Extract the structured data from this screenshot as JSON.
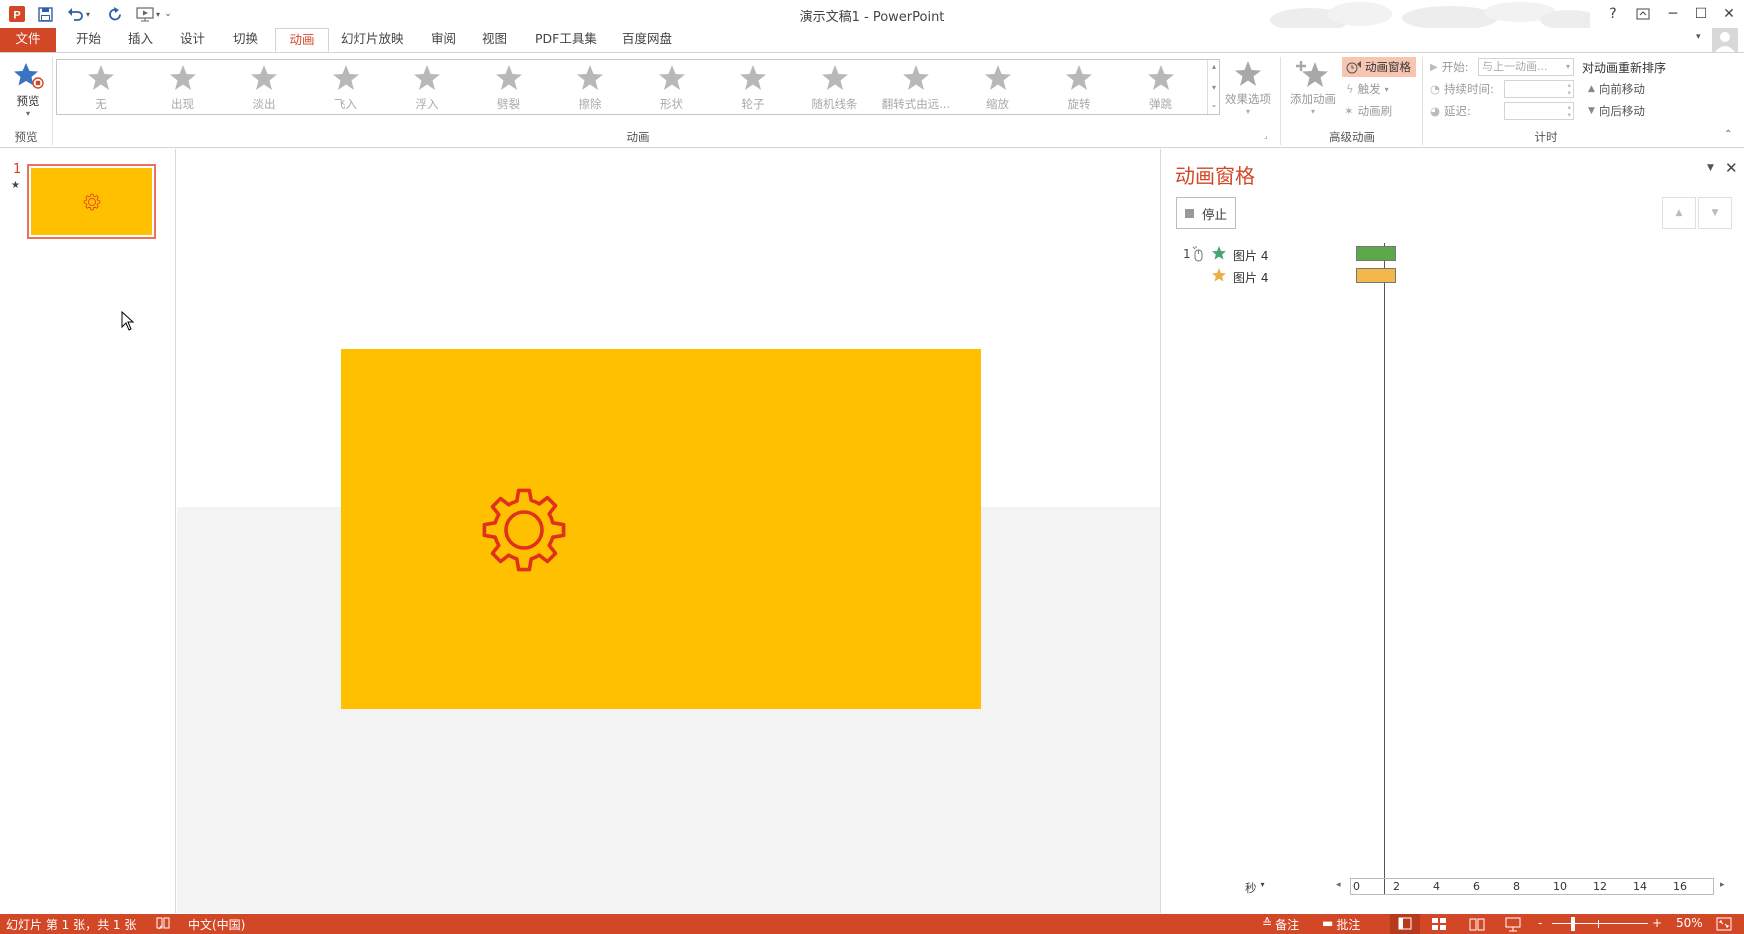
{
  "window": {
    "title": "演示文稿1 - PowerPoint",
    "help": "?",
    "minimize": "─",
    "maximize": "☐",
    "close": "✕"
  },
  "tabs": [
    "文件",
    "开始",
    "插入",
    "设计",
    "切换",
    "动画",
    "幻灯片放映",
    "审阅",
    "视图",
    "PDF工具集",
    "百度网盘"
  ],
  "active_tab": "动画",
  "ribbon": {
    "preview_label": "预览",
    "preview_group": "预览",
    "animation_group": "动画",
    "animations": [
      "无",
      "出现",
      "淡出",
      "飞入",
      "浮入",
      "劈裂",
      "擦除",
      "形状",
      "轮子",
      "随机线条",
      "翻转式由远...",
      "缩放",
      "旋转",
      "弹跳"
    ],
    "effect_options": "效果选项",
    "add_animation": "添加动画",
    "anim_pane_btn": "动画窗格",
    "trigger": "触发",
    "anim_painter": "动画刷",
    "advanced_group": "高级动画",
    "start_label": "开始:",
    "start_value": "与上一动画...",
    "duration_label": "持续时间:",
    "delay_label": "延迟:",
    "timing_group": "计时",
    "reorder_title": "对动画重新排序",
    "move_earlier": "向前移动",
    "move_later": "向后移动"
  },
  "thumbnails": [
    {
      "number": "1",
      "marker": "★"
    }
  ],
  "slide": {
    "background": "#FFC000",
    "gear_color": "#E0301E"
  },
  "anim_pane": {
    "title": "动画窗格",
    "stop_button": "停止",
    "items": [
      {
        "index": "1",
        "name": "图片 4",
        "star_color": "#4aa56f",
        "bar_color": "#5ea84c",
        "start": 0.0,
        "duration": 2.0
      },
      {
        "index": "",
        "name": "图片 4",
        "star_color": "#e8b04a",
        "bar_color": "#f2b84b",
        "start": 0.0,
        "duration": 2.0
      }
    ],
    "time_unit": "秒",
    "ruler_ticks": [
      "0",
      "2",
      "4",
      "6",
      "8",
      "10",
      "12",
      "14",
      "16"
    ]
  },
  "status": {
    "slide_info": "幻灯片 第 1 张，共 1 张",
    "language": "中文(中国)",
    "notes": "备注",
    "comments": "批注",
    "zoom": "50%",
    "zoom_minus": "-",
    "zoom_plus": "+"
  },
  "colors": {
    "accent": "#D24726",
    "slide_bg": "#FFC000",
    "status_bg": "#D24726"
  }
}
